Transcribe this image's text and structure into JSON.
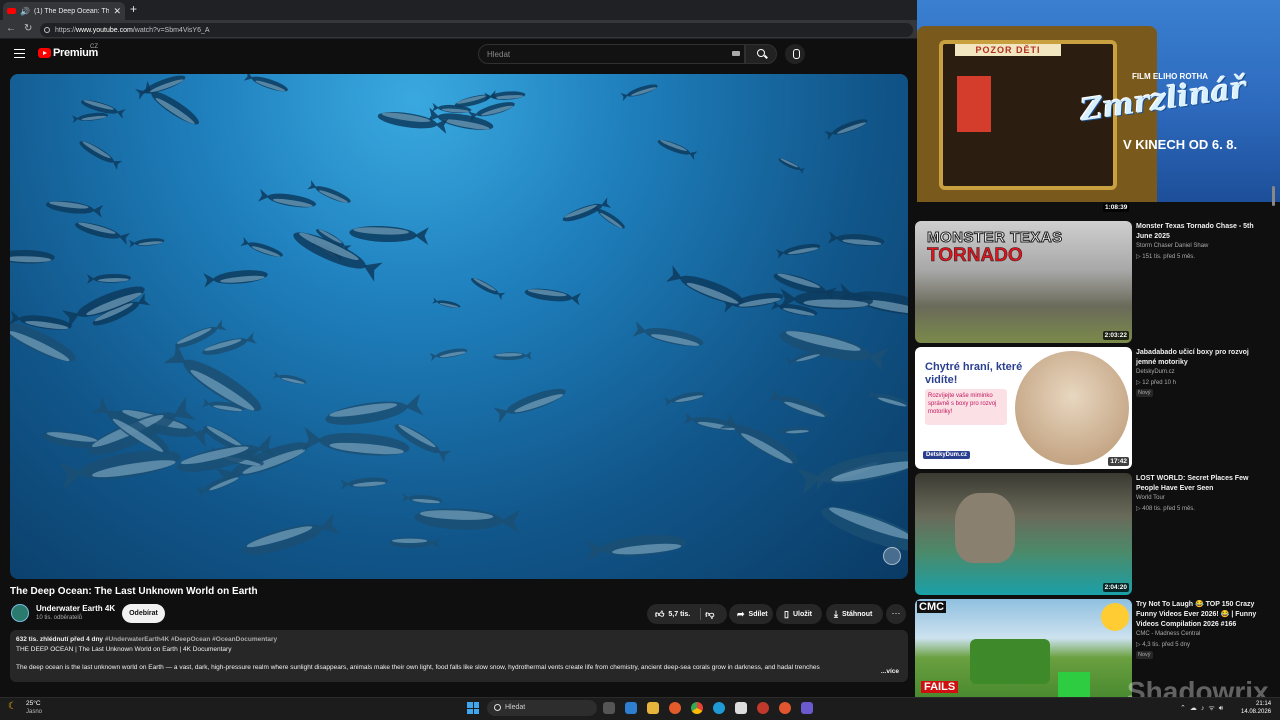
{
  "browser": {
    "tab_title": "(1) The Deep Ocean: The Last",
    "tab_close": "✕",
    "new_tab": "+",
    "url_prefix": "https://",
    "url_host": "www.youtube.com",
    "url_path": "/watch?v=Sbm4VisY6_A"
  },
  "header": {
    "logo_text": "Premium",
    "logo_region": "CZ",
    "search_placeholder": "Hledat"
  },
  "video": {
    "title": "The Deep Ocean: The Last Unknown World on Earth",
    "channel_name": "Underwater Earth 4K",
    "channel_subs": "10 tis. odběratelů",
    "subscribe_label": "Odebírat",
    "like_count": "5,7 tis.",
    "share_label": "Sdílet",
    "save_label": "Uložit",
    "download_label": "Stáhnout",
    "more_label": "···"
  },
  "description": {
    "meta": "632 tis. zhlédnutí  před 4 dny",
    "tags": "#UnderwaterEarth4K #DeepOcean #OceanDocumentary",
    "line2": "THE DEEP OCEAN | The Last Unknown World on Earth | 4K Documentary",
    "line3": "The deep ocean is the last unknown world on Earth — a vast, dark, high-pressure realm where sunlight disappears, animals make their own light, food falls like slow snow, hydrothermal vents create life from chemistry, ancient deep-sea corals grow in darkness, and hadal trenches",
    "more": "...více"
  },
  "ad": {
    "sign": "POZOR DĚTI",
    "film_label": "FILM ELIHO ROTHA",
    "logo": "Zmrzlinář",
    "date": "V KINECH OD 6. 8.",
    "duration": "1:08:39"
  },
  "sidebar": {
    "videos": [
      {
        "title": "Monster Texas Tornado Chase - 5th June 2025",
        "channel": "Storm Chaser Daniel Shaw",
        "stats": "▷ 151 tis.  před 5 měs.",
        "duration": "2:03:22",
        "thumb_line1": "MONSTER TEXAS",
        "thumb_line2": "TORNADO"
      },
      {
        "title": "Jabadabado učicí boxy pro rozvoj jemné motoriky",
        "channel": "DetskyDum.cz",
        "stats": "▷ 12  před 10 h",
        "badge": "Nový",
        "duration": "17:42",
        "thumb_headline": "Chytré hraní, které vidíte!",
        "thumb_box": "Rozvíjejte vaše miminko správně s boxy pro rozvoj motoriky!",
        "thumb_logo": "DetskyDum.cz"
      },
      {
        "title": "LOST WORLD: Secret Places Few People Have Ever Seen",
        "channel": "World Tour",
        "stats": "▷ 408 tis.  před 5 měs.",
        "duration": "2:04:20"
      },
      {
        "title": "Try Not To Laugh 😂 TOP 150 Crazy Funny Videos Ever 2026! 😂 | Funny Videos Compilation 2026 #166",
        "channel": "CMC - Madness Central",
        "stats": "▷ 4,3 tis.  před 5 dny",
        "badge": "Nový",
        "thumb_tag": "CMC",
        "thumb_fails": "FAILS"
      }
    ]
  },
  "watermark": "Shadowrix",
  "taskbar": {
    "temp": "25°C",
    "weather": "Jasno",
    "search": "Hledat",
    "time": "21:14",
    "date": "14.08.2026"
  }
}
